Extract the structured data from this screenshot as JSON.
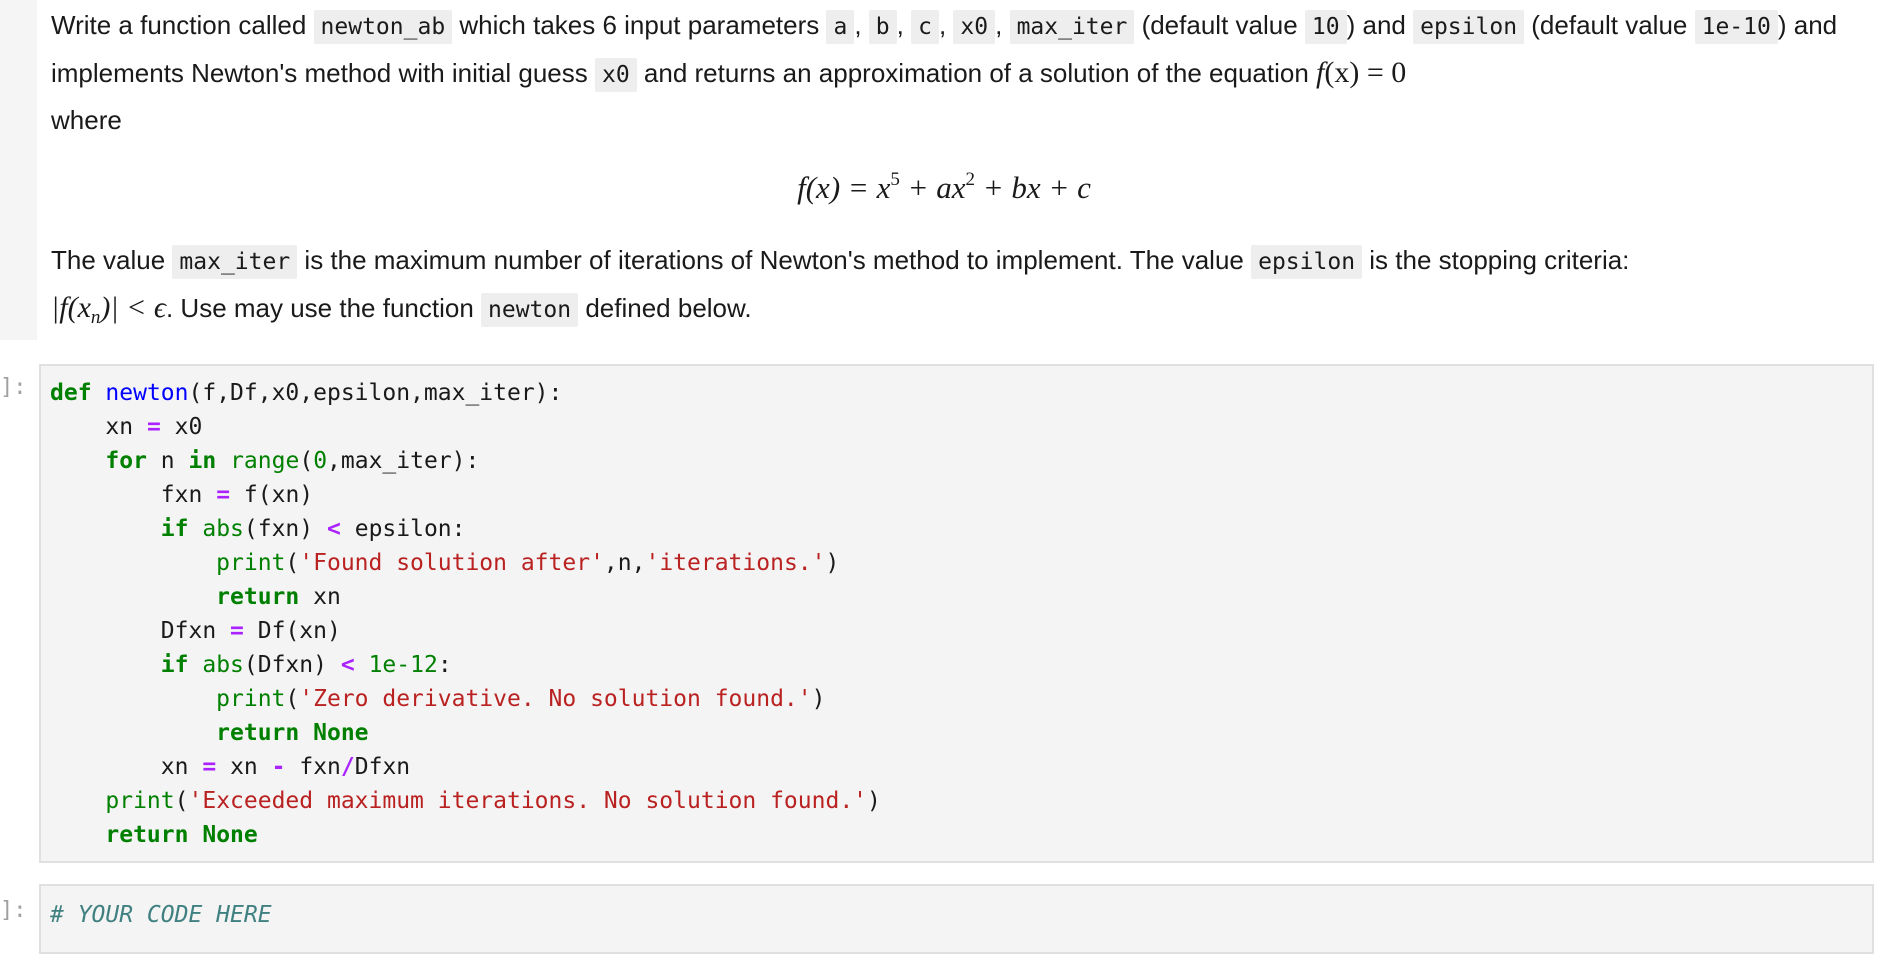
{
  "markdown_cell": {
    "paragraph1": {
      "t1": "Write a function called ",
      "c_func": "newton_ab",
      "t2": " which takes 6 input parameters ",
      "c_a": "a",
      "sep1": ", ",
      "c_b": "b",
      "sep2": ", ",
      "c_c": "c",
      "sep3": ", ",
      "c_x0": "x0",
      "sep4": ", ",
      "c_max_iter": "max_iter",
      "t3": " (default value ",
      "c_10": "10",
      "t4": ") and ",
      "c_epsilon": "epsilon",
      "t5": " (default value ",
      "c_1e10": "1e-10",
      "t6": ") and implements Newton's method with initial guess ",
      "c_x0b": "x0",
      "t7": " and returns an approximation of a solution of the equation ",
      "m_fx": "f",
      "m_paren": "(x) = 0",
      "t8": " where"
    },
    "equation": {
      "lhs": "f(x) = x",
      "exp1": "5",
      "mid1": " + ax",
      "exp2": "2",
      "rest": " + bx + c"
    },
    "paragraph2": {
      "t1": "The value ",
      "c_max_iter": "max_iter",
      "t2": " is the maximum number of iterations of Newton's method to implement. The value ",
      "c_epsilon": "epsilon",
      "t3": " is the stopping criteria: ",
      "m_abs": "|f(x",
      "m_sub": "n",
      "m_rest": ")| < ϵ",
      "t4": ". Use may use the function ",
      "c_newton": "newton",
      "t5": " defined below."
    }
  },
  "code_cell_1": {
    "prompt": "]:",
    "tokens": {
      "def": "def",
      "newton": "newton",
      "sig": "(f,Df,x0,epsilon,max_iter):",
      "xn": "xn",
      "eq": "=",
      "x0": "x0",
      "for": "for",
      "n": "n",
      "in": "in",
      "range": "range",
      "rp1": "(",
      "zero": "0",
      "rp2": ",max_iter):",
      "fxn": "fxn",
      "fcall": "f(xn)",
      "if": "if",
      "abs": "abs",
      "absarg1": "(fxn)",
      "lt": "<",
      "eps": "epsilon:",
      "print": "print",
      "lp": "(",
      "s1": "'Found solution after'",
      "mid": ",n,",
      "s2": "'iterations.'",
      "rp": ")",
      "return": "return",
      "ret_xn": "xn",
      "dfxn": "Dfxn",
      "dfcall": "Df(xn)",
      "absarg2": "(Dfxn)",
      "tol": "1e-12",
      "colon": ":",
      "s3": "'Zero derivative. No solution found.'",
      "none": "None",
      "upd_lhs": "xn",
      "upd_xn": "xn",
      "minus": "-",
      "upd_fxn": "fxn",
      "slash": "/",
      "upd_dfxn": "Dfxn",
      "s4": "'Exceeded maximum iterations. No solution found.'"
    }
  },
  "code_cell_2": {
    "prompt": "]:",
    "comment": "# YOUR CODE HERE"
  }
}
